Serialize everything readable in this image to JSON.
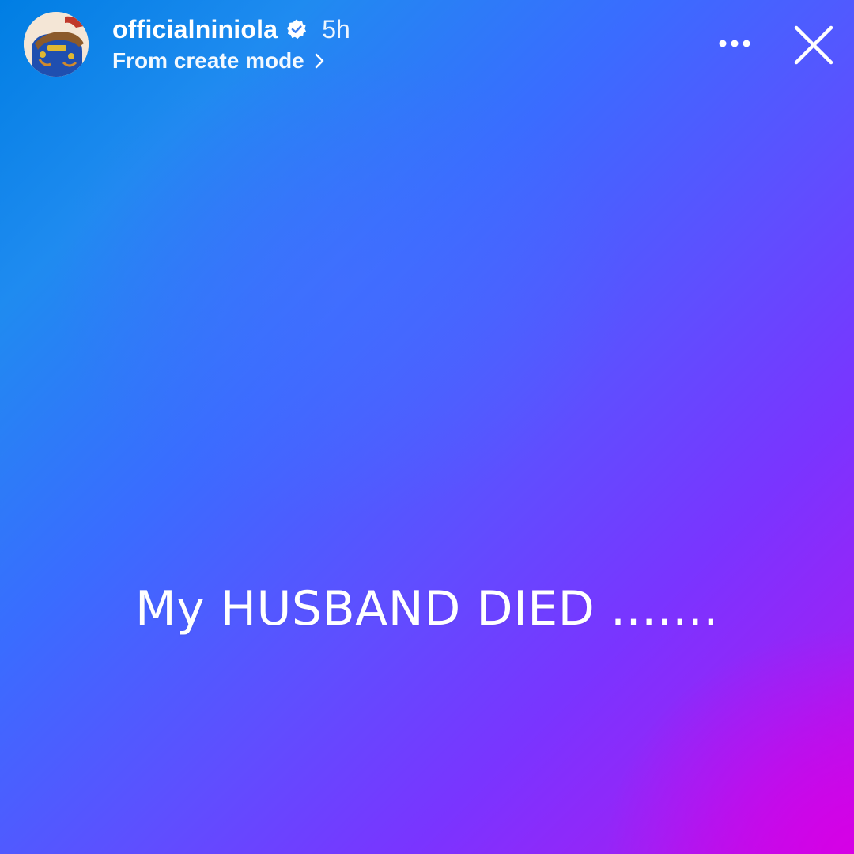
{
  "header": {
    "username": "officialniniola",
    "verified": true,
    "time_ago": "5h",
    "subtitle": "From create mode"
  },
  "story": {
    "text": "My HUSBAND DIED .......",
    "background_colors": [
      "#007ee3",
      "#3a6cff",
      "#7a34ff",
      "#d700e6"
    ]
  },
  "icons": {
    "verified": "verified-badge-icon",
    "subtitle_chevron": "chevron-right-icon",
    "more": "more-options-icon",
    "close": "close-icon",
    "avatar": "profile-avatar"
  }
}
